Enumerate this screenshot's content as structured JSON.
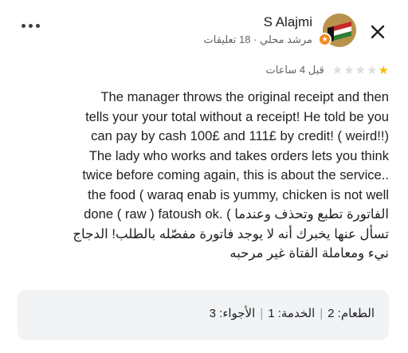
{
  "header": {
    "user_name": "S Alajmi",
    "user_meta": "مرشد محلي · 18 تعليقات",
    "more_icon": "more-horizontal-icon",
    "close_icon": "close-icon",
    "badge_icon": "local-guide-star-icon"
  },
  "rating": {
    "stars": 1,
    "max_stars": 5,
    "time_ago": "قبل 4 ساعات",
    "star_color": "#fbbc04",
    "empty_star_color": "#dadce0"
  },
  "review": {
    "lines": [
      "The manager throws the original receipt and then",
      "tells your your total without a receipt! He told be you",
      "can pay by cash 100£ and 111£ by credit! ( weird!!)",
      "The lady who works and takes orders lets you think",
      "twice before coming again, this is about the service..",
      "the food ( waraq enab is yummy, chicken is not well",
      "done ( raw ) fatoush ok. ( الفاتورة تطبع وتحذف وعندما",
      "تسأل عنها يخبرك أنه لا يوجد فاتورة مفصّله بالطلب! الدجاج",
      "نيء ومعاملة الفتاة غير مرحبه"
    ]
  },
  "attributes": {
    "food": "الطعام: 2",
    "service": "الخدمة: 1",
    "atmosphere": "الأجواء: 3",
    "separator": "|"
  }
}
